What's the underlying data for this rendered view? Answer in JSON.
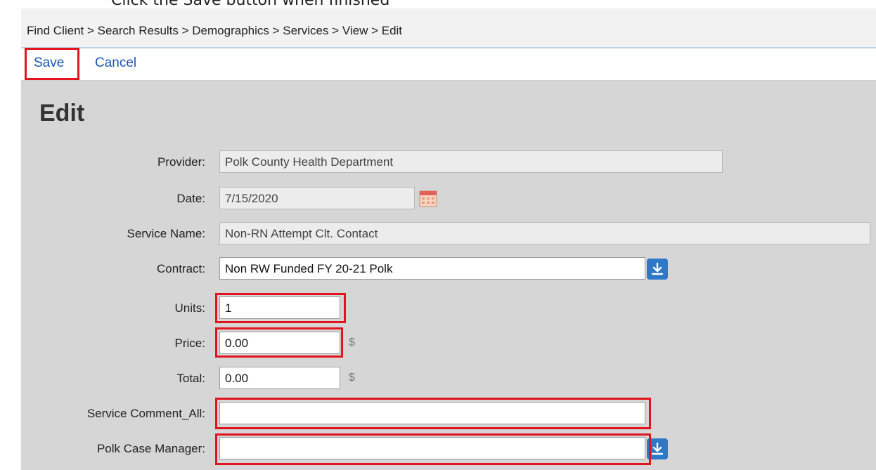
{
  "instruction": "Click the Save button when finished",
  "breadcrumb": "Find Client > Search Results > Demographics > Services > View > Edit",
  "toolbar": {
    "save_label": "Save",
    "cancel_label": "Cancel"
  },
  "page_title": "Edit",
  "form": {
    "provider": {
      "label": "Provider:",
      "value": "Polk County Health Department"
    },
    "date": {
      "label": "Date:",
      "value": "7/15/2020"
    },
    "service_name": {
      "label": "Service Name:",
      "value": "Non-RN Attempt Clt. Contact"
    },
    "contract": {
      "label": "Contract:",
      "value": "Non RW Funded FY 20-21 Polk"
    },
    "units": {
      "label": "Units:",
      "value": "1"
    },
    "price": {
      "label": "Price:",
      "value": "0.00",
      "unit": "$"
    },
    "total": {
      "label": "Total:",
      "value": "0.00",
      "unit": "$"
    },
    "service_comment": {
      "label": "Service Comment_All:",
      "value": ""
    },
    "case_manager": {
      "label": "Polk Case Manager:",
      "value": ""
    }
  },
  "colors": {
    "highlight": "#e3141f",
    "link": "#1a56b3",
    "dropdown_button": "#2d79c7"
  },
  "icons": {
    "calendar": "calendar-icon",
    "dropdown": "download-arrow-icon"
  }
}
